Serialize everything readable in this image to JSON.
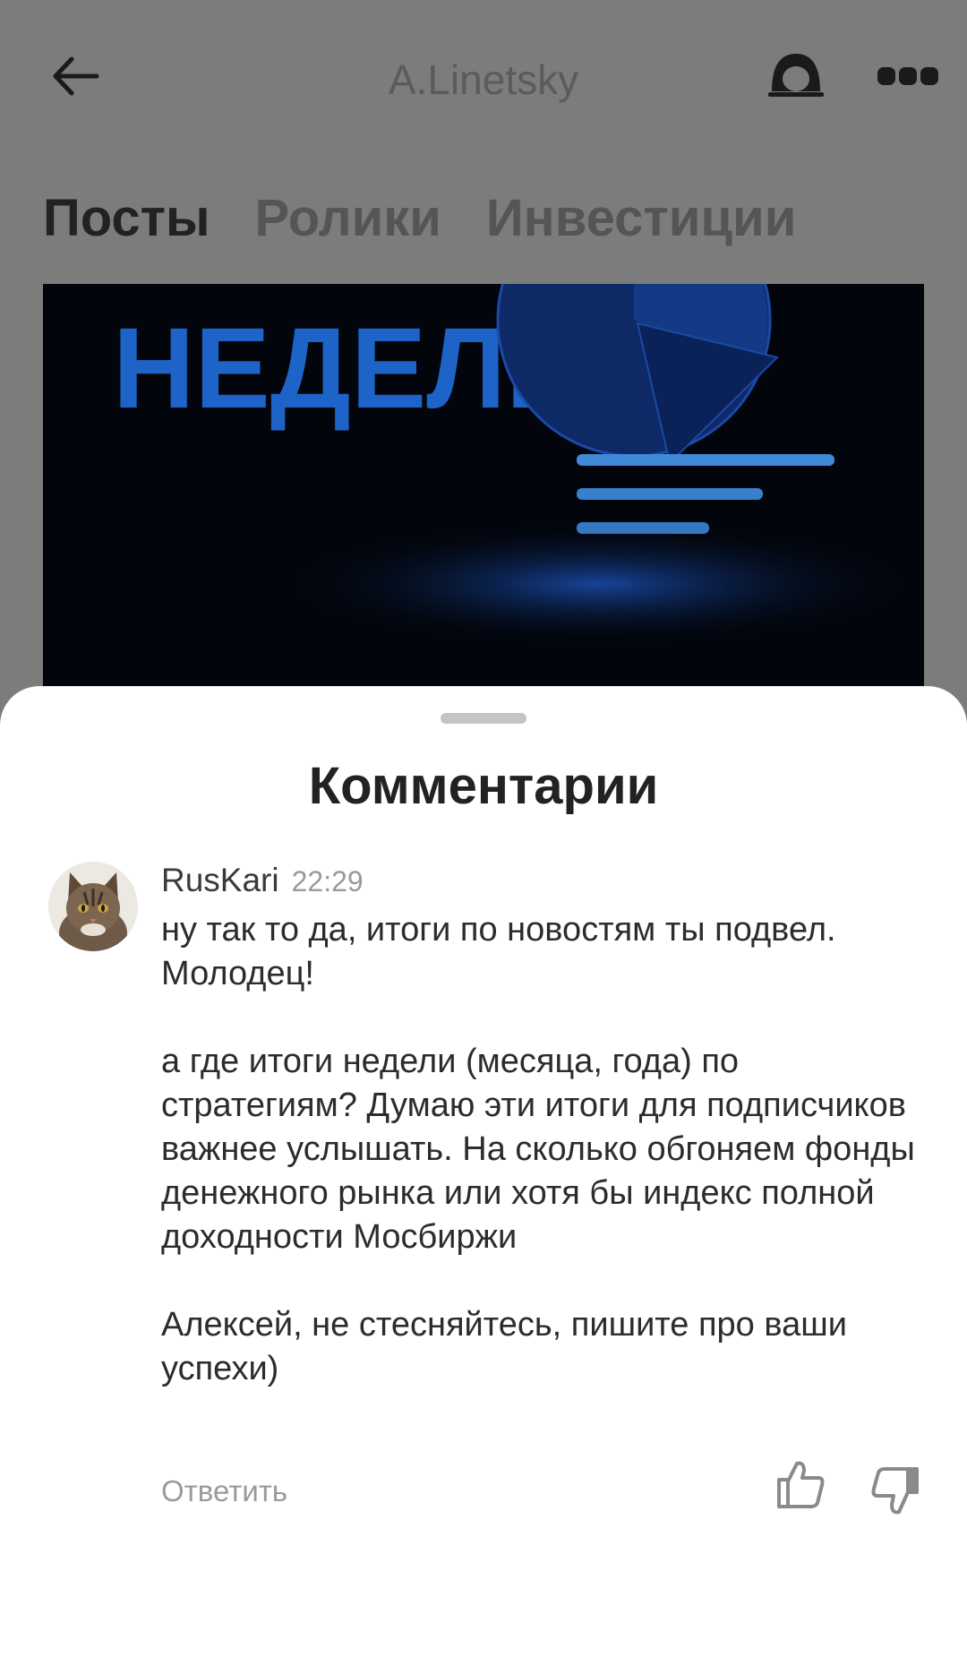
{
  "header": {
    "title": "A.Linetsky",
    "back_icon": "arrow-left-icon",
    "profile_icon": "profile-icon",
    "more_icon": "more-dots-icon"
  },
  "tabs": [
    {
      "label": "Посты",
      "active": true
    },
    {
      "label": "Ролики",
      "active": false
    },
    {
      "label": "Инвестиции",
      "active": false
    }
  ],
  "banner": {
    "text": "НЕДЕЛИ",
    "text_color": "#1d63c8",
    "background": "#02050c"
  },
  "comments_sheet": {
    "title": "Комментарии",
    "comment": {
      "username": "RusKari",
      "time": "22:29",
      "text": "ну так то да, итоги по новостям ты подвел. Молодец!\n\nа где итоги недели (месяца, года) по стратегиям? Думаю эти итоги для подписчиков важнее услышать. На сколько обгоняем фонды денежного рынка или хотя бы индекс полной доходности Мосбиржи\n\nАлексей, не стесняйтесь, пишите про ваши успехи)",
      "reply_label": "Ответить",
      "like_icon": "thumbs-up-icon",
      "dislike_icon": "thumbs-down-icon"
    }
  },
  "colors": {
    "overlay_bg": "#7c7c7c",
    "sheet_bg": "#ffffff",
    "text_primary": "#2c2c2c",
    "text_secondary": "#9a9a9a"
  }
}
